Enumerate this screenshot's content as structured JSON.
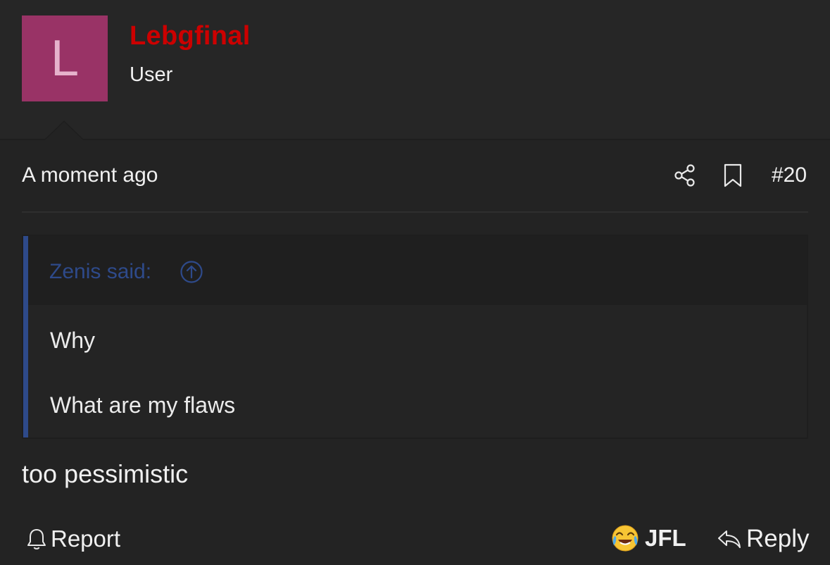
{
  "author": {
    "avatar_letter": "L",
    "avatar_color": "#993366",
    "username": "Lebgfinal",
    "username_color": "#cc0000",
    "user_title": "User"
  },
  "post_meta": {
    "timestamp": "A moment ago",
    "post_number": "#20",
    "icons": [
      "share-icon",
      "bookmark-icon"
    ]
  },
  "quote": {
    "author_label": "Zenis said:",
    "accent_color": "#2e4a8a",
    "lines": [
      "Why",
      "What are my flaws"
    ]
  },
  "message": "too pessimistic",
  "actions": {
    "report_label": "Report",
    "reaction_label": "JFL",
    "reaction_icon": "face-with-tears-of-joy-icon",
    "reply_label": "Reply"
  }
}
